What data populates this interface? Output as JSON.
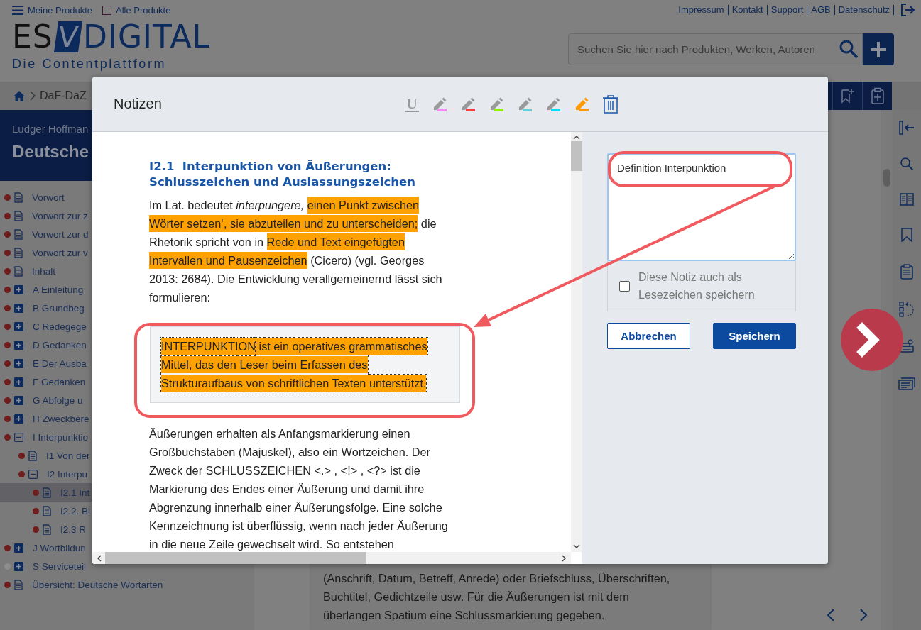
{
  "top_bar": {
    "menu_label": "Meine Produkte",
    "all_products": {
      "label": "Alle Produkte",
      "checked": false
    },
    "links": [
      "Impressum",
      "Kontakt",
      "Support",
      "AGB",
      "Datenschutz"
    ]
  },
  "logo": {
    "left": "ES",
    "mark": "V",
    "right": "DIGITAL",
    "tagline": "Die Contentplattform"
  },
  "search": {
    "placeholder": "Suchen Sie hier nach Produkten, Werken, Autoren"
  },
  "breadcrumb": [
    "DaF-DaZ"
  ],
  "sidebar": {
    "author": "Ludger Hoffman",
    "title": "Deutsche",
    "items": [
      {
        "label": "Vorwort",
        "kind": "page",
        "selected": false,
        "color": "#6e1c1c"
      },
      {
        "label": "Vorwort zur z",
        "kind": "page",
        "selected": false,
        "color": "#6e1c1c"
      },
      {
        "label": "Vorwort zur d",
        "kind": "page",
        "selected": false,
        "color": "#6e1c1c"
      },
      {
        "label": "Vorwort zur v",
        "kind": "page",
        "selected": false,
        "color": "#6e1c1c"
      },
      {
        "label": "Inhalt",
        "kind": "page",
        "selected": false,
        "color": "#6e1c1c"
      },
      {
        "label": "A Einleitung",
        "kind": "section",
        "expanded": false,
        "selected": false,
        "color": "#6e1c1c"
      },
      {
        "label": "B Grundbeg",
        "kind": "section",
        "expanded": false,
        "selected": false,
        "color": "#6e1c1c"
      },
      {
        "label": "C Redegege",
        "kind": "section",
        "expanded": false,
        "selected": false,
        "color": "#6e1c1c"
      },
      {
        "label": "D Gedanken",
        "kind": "section",
        "expanded": false,
        "selected": false,
        "color": "#6e1c1c"
      },
      {
        "label": "E Der Ausba",
        "kind": "section",
        "expanded": false,
        "selected": false,
        "color": "#6e1c1c"
      },
      {
        "label": "F Gedanken",
        "kind": "section",
        "expanded": false,
        "selected": false,
        "color": "#6e1c1c"
      },
      {
        "label": "G Abfolge u",
        "kind": "section",
        "expanded": false,
        "selected": false,
        "color": "#6e1c1c"
      },
      {
        "label": "H Zweckbere",
        "kind": "section",
        "expanded": false,
        "selected": false,
        "color": "#6e1c1c"
      },
      {
        "label": "I Interpunktio",
        "kind": "section",
        "expanded": true,
        "selected": false,
        "color": "#6e1c1c",
        "children": [
          {
            "label": "I1 Von der",
            "kind": "page",
            "selected": false,
            "color": "#6e1c1c"
          },
          {
            "label": "I2 Interpu",
            "kind": "section",
            "expanded": true,
            "selected": false,
            "color": "#6e1c1c",
            "children": [
              {
                "label": "I2.1 Int",
                "kind": "page",
                "selected": true,
                "color": "#6e1c1c"
              },
              {
                "label": "I2.2. Bi",
                "kind": "page",
                "selected": false,
                "color": "#6e1c1c"
              },
              {
                "label": "I2.3 R",
                "kind": "page",
                "selected": false,
                "color": "#6e1c1c"
              }
            ]
          }
        ]
      },
      {
        "label": "J Wortbildun",
        "kind": "section",
        "expanded": false,
        "selected": false,
        "color": "#6e1c1c"
      },
      {
        "label": "S Serviceteil",
        "kind": "section",
        "expanded": false,
        "selected": false,
        "color": "#8c8c8c"
      },
      {
        "label": "Übersicht: Deutsche Wortarten",
        "kind": "page",
        "selected": false,
        "color": "#6e1c1c"
      }
    ]
  },
  "article": {
    "text": "(Anschrift, Datum, Betreff, Anrede) oder Briefschluss, Überschriften, Buchtitel, Gedichtzeile usw. Für die Äußerungen ist mit dem überlangen Spatium eine Schlussmarkierung gegeben."
  },
  "modal": {
    "title": "Notizen",
    "tools": [
      {
        "kind": "underline",
        "label": "U",
        "selected": false
      },
      {
        "kind": "highlighter",
        "color": "#ff88ee",
        "selected": false
      },
      {
        "kind": "highlighter",
        "color": "#ff3b3b",
        "selected": false
      },
      {
        "kind": "highlighter",
        "color": "#99ee00",
        "selected": false
      },
      {
        "kind": "highlighter",
        "color": "#66ccdd",
        "selected": false
      },
      {
        "kind": "highlighter",
        "color": "#00ddff",
        "selected": false
      },
      {
        "kind": "highlighter",
        "color": "#ff9900",
        "selected": true
      },
      {
        "kind": "delete",
        "selected": false
      }
    ],
    "document": {
      "heading": "I2.1  Interpunktion von Äußerungen: Schlusszeichen und Auslassungszeichen",
      "blocks": [
        {
          "kind": "paragraph",
          "segments": [
            {
              "text": "Im Lat. bedeutet *interpungere,* ",
              "highlighted": false
            },
            {
              "text": "einen Punkt zwischen Wörter setzen‘, sie abzuteilen und zu unterscheiden;",
              "highlighted": true
            },
            {
              "text": " die Rhetorik spricht von in ",
              "highlighted": false
            },
            {
              "text": "Rede und Text eingefügten Intervallen und Pausenzeichen",
              "highlighted": true
            },
            {
              "text": " (Cicero) (vgl. Georges 2013: 2684). Die Entwicklung verallgemeinernd lässt sich formulieren:",
              "highlighted": false
            }
          ]
        },
        {
          "kind": "quote",
          "segments": [
            {
              "text": "INTERPUNKTION",
              "highlighted": true
            },
            {
              "text": " ist ein operatives grammatisches Mittel, das den Leser beim Erfassen des Strukturaufbaus von schriftlichen Texten unterstützt.",
              "highlighted": true
            }
          ]
        },
        {
          "kind": "paragraph",
          "segments": [
            {
              "text": "Äußerungen erhalten als Anfangsmarkierung einen Großbuchstaben (Majuskel), also ein Wortzeichen. Der Zweck der SCHLUSSZEICHEN <.> , <!> , <?> ist die Markierung des Endes einer Äußerung und damit ihre Abgrenzung innerhalb einer Äußerungsfolge. Eine solche Kennzeichnung ist überflüssig, wenn nach jeder Äußerung in die neue Zeile gewechselt wird. So entstehen",
              "highlighted": false
            }
          ]
        }
      ]
    },
    "note": {
      "value": "Definition Interpunktion"
    },
    "bookmark": {
      "label": "Diese Notiz auch als Lesezeichen speichern",
      "checked": false
    },
    "buttons": [
      {
        "label": "Abbrechen",
        "kind": "secondary"
      },
      {
        "label": "Speichern",
        "kind": "primary"
      }
    ]
  }
}
